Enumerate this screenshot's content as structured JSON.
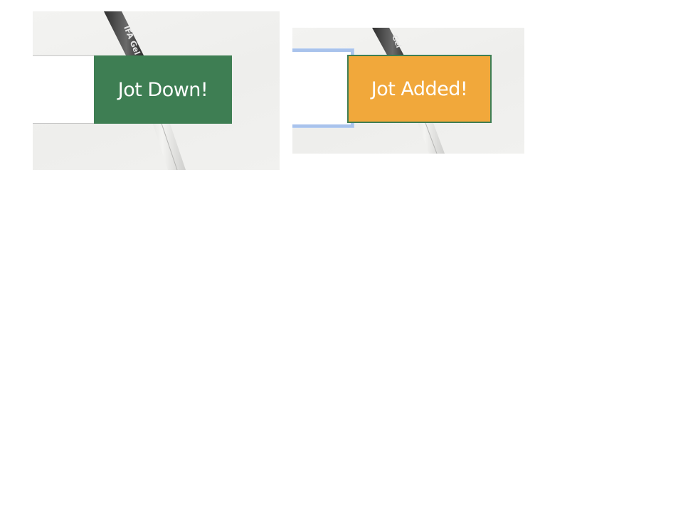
{
  "panels": {
    "default": {
      "input_value": "",
      "button_label": "Jot Down!",
      "button_color": "#3e7e53"
    },
    "submitted": {
      "input_value": "",
      "button_label": "Jot Added!",
      "button_color": "#f1a83b",
      "focus_ring_color": "#a9c3ec"
    }
  },
  "background": {
    "image_subject": "pen-on-white-desk",
    "pen_imprint": "IFA Gel"
  }
}
